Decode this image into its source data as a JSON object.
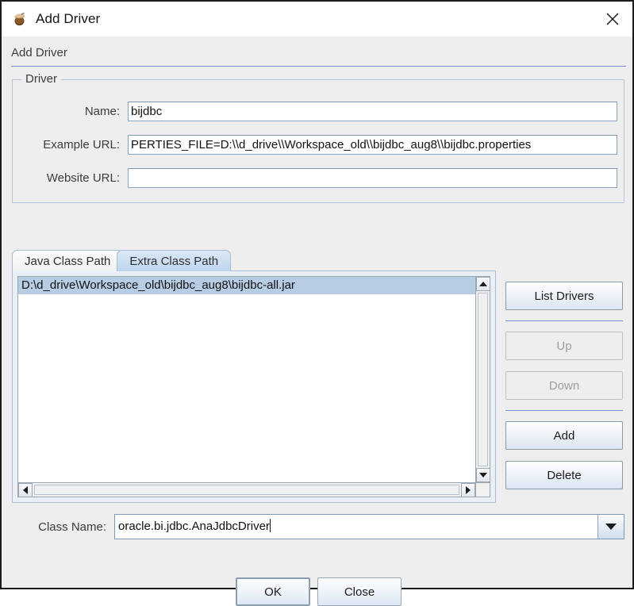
{
  "window": {
    "title": "Add Driver",
    "icon": "acorn-icon",
    "close_icon": "close-icon"
  },
  "section": {
    "header": "Add Driver"
  },
  "driver_group": {
    "legend": "Driver",
    "fields": [
      {
        "label": "Name:",
        "value": "bijdbc"
      },
      {
        "label": "Example URL:",
        "value": "PERTIES_FILE=D:\\\\d_drive\\\\Workspace_old\\\\bijdbc_aug8\\\\bijdbc.properties"
      },
      {
        "label": "Website URL:",
        "value": ""
      }
    ]
  },
  "tabs": [
    {
      "label": "Java Class Path",
      "active": false
    },
    {
      "label": "Extra Class Path",
      "active": true
    }
  ],
  "classpath_list": {
    "items": [
      {
        "text": "D:\\d_drive\\Workspace_old\\bijdbc_aug8\\bijdbc-all.jar",
        "selected": true
      }
    ],
    "scrollbar_up_icon": "triangle-up-icon",
    "scrollbar_down_icon": "triangle-down-icon",
    "scrollbar_left_icon": "triangle-left-icon",
    "scrollbar_right_icon": "triangle-right-icon"
  },
  "side_buttons": [
    {
      "label": "List Drivers",
      "enabled": true
    },
    {
      "label": "Up",
      "enabled": false
    },
    {
      "label": "Down",
      "enabled": false
    },
    {
      "label": "Add",
      "enabled": true
    },
    {
      "label": "Delete",
      "enabled": true
    }
  ],
  "class_name": {
    "label": "Class Name:",
    "value": "oracle.bi.jdbc.AnaJdbcDriver",
    "dropdown_icon": "chevron-down-icon"
  },
  "footer": {
    "ok_label": "OK",
    "close_label": "Close"
  },
  "colors": {
    "dialog_background": "#eeeeee",
    "accent_rule": "#7a93c4",
    "selection": "#b6cde4",
    "tab_active_top": "#dbe8f6",
    "tab_active_bottom": "#bdd6ef",
    "field_border": "#8aa4c0",
    "disabled_text": "#9d9d9d"
  }
}
